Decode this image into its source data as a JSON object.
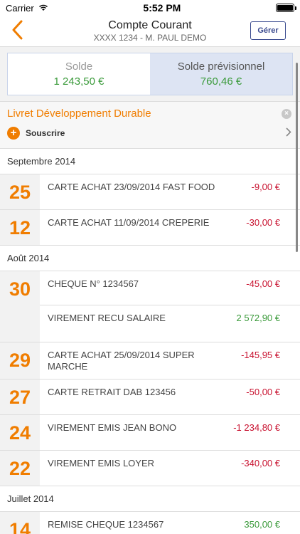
{
  "status": {
    "carrier": "Carrier",
    "time": "5:52 PM",
    "battery_fraction": 1.0
  },
  "nav": {
    "title": "Compte Courant",
    "subtitle": "XXXX 1234 - M. PAUL DEMO",
    "manage_label": "Gérer"
  },
  "balance": {
    "solde_label": "Solde",
    "solde_value": "1 243,50 €",
    "prev_label": "Solde prévisionnel",
    "prev_value": "760,46 €"
  },
  "promo": {
    "title": "Livret Développement Durable",
    "subscribe_label": "Souscrire"
  },
  "months": [
    {
      "label": "Septembre 2014",
      "days": [
        {
          "day": "25",
          "h": 50,
          "txns": [
            {
              "label": "CARTE ACHAT 23/09/2014 FAST FOOD",
              "amount": "-9,00 €",
              "sign": "neg",
              "h": 50
            }
          ]
        },
        {
          "day": "12",
          "h": 50,
          "txns": [
            {
              "label": "CARTE ACHAT 11/09/2014 CREPERIE",
              "amount": "-30,00 €",
              "sign": "neg",
              "h": 50
            }
          ]
        }
      ]
    },
    {
      "label": "Août 2014",
      "days": [
        {
          "day": "30",
          "h": 100,
          "txns": [
            {
              "label": "CHEQUE N° 1234567",
              "amount": "-45,00 €",
              "sign": "neg",
              "h": 48
            },
            {
              "label": "VIREMENT RECU SALAIRE",
              "amount": "2 572,90 €",
              "sign": "pos",
              "h": 52
            }
          ]
        },
        {
          "day": "29",
          "h": 52,
          "txns": [
            {
              "label": "CARTE ACHAT 25/09/2014 SUPER MARCHE",
              "amount": "-145,95 €",
              "sign": "neg",
              "h": 52
            }
          ]
        },
        {
          "day": "27",
          "h": 50,
          "txns": [
            {
              "label": "CARTE RETRAIT DAB 123456",
              "amount": "-50,00 €",
              "sign": "neg",
              "h": 50
            }
          ]
        },
        {
          "day": "24",
          "h": 50,
          "txns": [
            {
              "label": "VIREMENT EMIS JEAN BONO",
              "amount": "-1 234,80 €",
              "sign": "neg",
              "h": 50
            }
          ]
        },
        {
          "day": "22",
          "h": 50,
          "txns": [
            {
              "label": "VIREMENT EMIS LOYER",
              "amount": "-340,00 €",
              "sign": "neg",
              "h": 50
            }
          ]
        }
      ]
    },
    {
      "label": "Juillet 2014",
      "days": [
        {
          "day": "14",
          "h": 50,
          "txns": [
            {
              "label": "REMISE CHEQUE 1234567",
              "amount": "350,00 €",
              "sign": "pos",
              "h": 50
            }
          ]
        }
      ]
    }
  ]
}
